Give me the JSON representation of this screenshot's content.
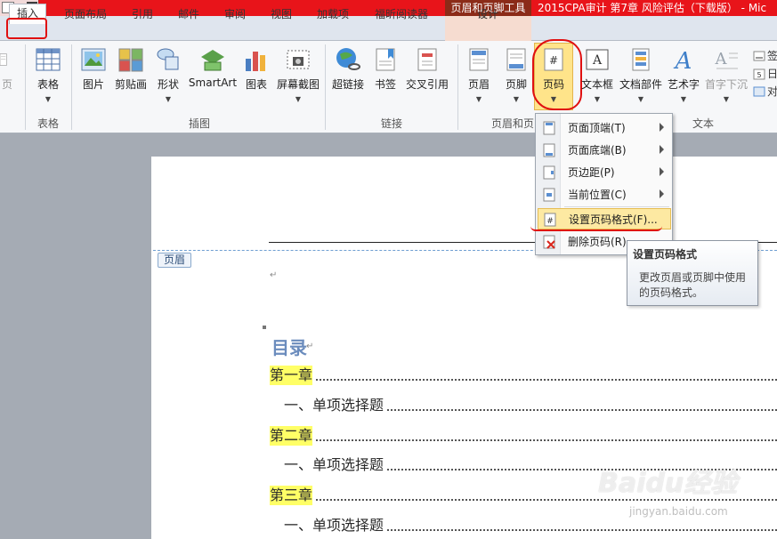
{
  "titlebar": {
    "context_tool": "页眉和页脚工具",
    "doc_title": "2015CPA审计 第7章  风险评估（下载版） - Mic"
  },
  "tabs": {
    "insert": "插入",
    "page_layout": "页面布局",
    "references": "引用",
    "mailings": "邮件",
    "review": "审阅",
    "view": "视图",
    "addins": "加载项",
    "foxit": "福昕阅读器",
    "design": "设计"
  },
  "ribbon": {
    "partial_left": "页",
    "buttons": {
      "table": "表格",
      "picture": "图片",
      "clipart": "剪贴画",
      "shapes": "形状",
      "smartart": "SmartArt",
      "chart": "图表",
      "screenshot": "屏幕截图",
      "hyperlink": "超链接",
      "bookmark": "书签",
      "crossref": "交叉引用",
      "header": "页眉",
      "footer": "页脚",
      "page_number": "页码",
      "textbox": "文本框",
      "quickparts": "文档部件",
      "wordart": "艺术字",
      "dropcap": "首字下沉"
    },
    "groups": {
      "tables": "表格",
      "illustrations": "插图",
      "links": "链接",
      "header_footer": "页眉和页",
      "text": "文本"
    },
    "right_small": [
      "签",
      "日",
      "对"
    ]
  },
  "menu": {
    "items": [
      {
        "label": "页面顶端(T)",
        "submenu": true
      },
      {
        "label": "页面底端(B)",
        "submenu": true
      },
      {
        "label": "页边距(P)",
        "submenu": true
      },
      {
        "label": "当前位置(C)",
        "submenu": true
      },
      {
        "label": "设置页码格式(F)...",
        "submenu": false
      },
      {
        "label": "删除页码(R)",
        "submenu": false
      }
    ]
  },
  "tooltip": {
    "title": "设置页码格式",
    "body": "更改页眉或页脚中使用的页码格式。"
  },
  "document": {
    "header_tag": "页眉",
    "toc_title": "目录",
    "toc": [
      {
        "text": "第一章",
        "highlight": true
      },
      {
        "text": "一、单项选择题",
        "highlight": false
      },
      {
        "text": "第二章",
        "highlight": true
      },
      {
        "text": "一、单项选择题",
        "highlight": false
      },
      {
        "text": "第三章",
        "highlight": true
      },
      {
        "text": "一、单项选择题",
        "highlight": false
      }
    ]
  },
  "watermark": {
    "logo": "Baidu经验",
    "url": "jingyan.baidu.com"
  }
}
